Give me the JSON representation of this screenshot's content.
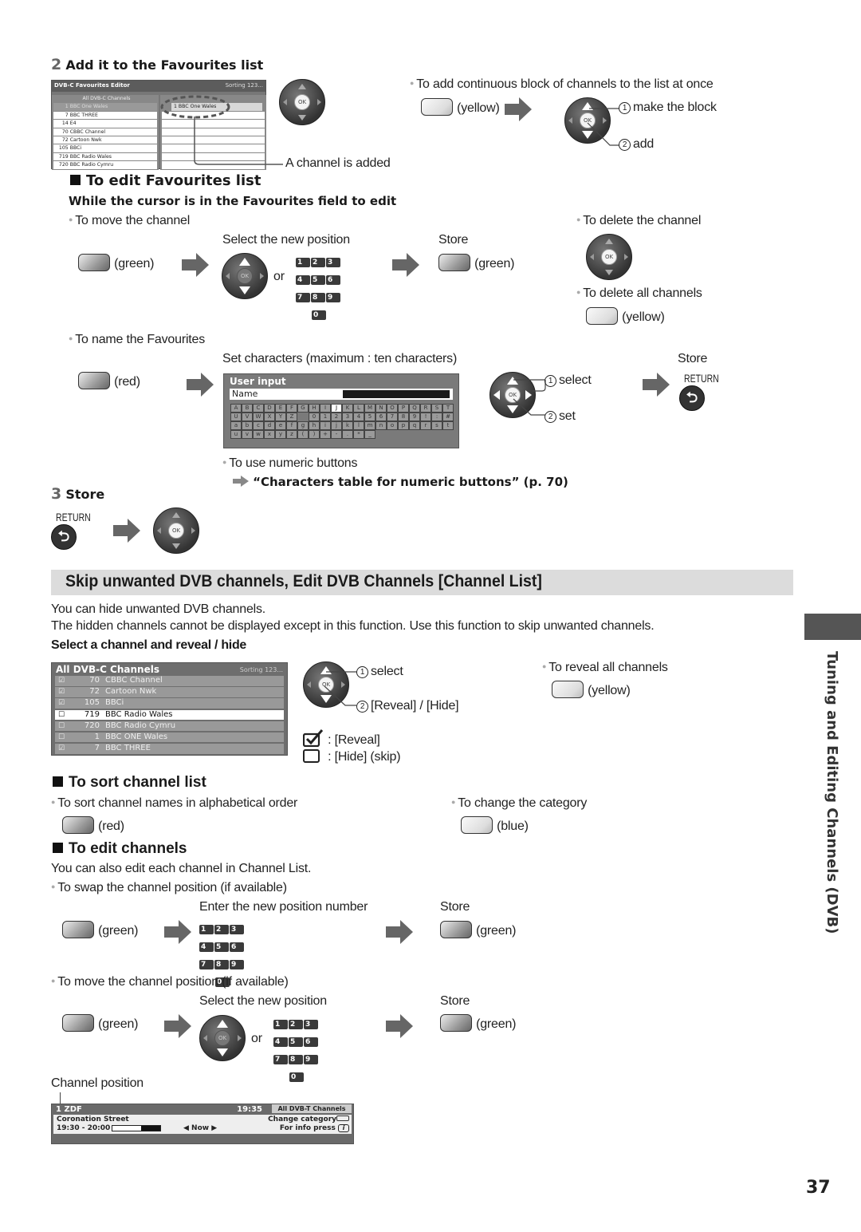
{
  "step2": {
    "num": "2",
    "title": "Add it to the Favourites list"
  },
  "fav_editor": {
    "title": "DVB-C Favourites Editor",
    "sorting": "Sorting 123...",
    "left_header": "All DVB-C Channels",
    "left_rows": [
      {
        "num": "1",
        "name": "BBC One Wales",
        "dim": true
      },
      {
        "num": "7",
        "name": "BBC THREE"
      },
      {
        "num": "14",
        "name": "E4"
      },
      {
        "num": "70",
        "name": "CBBC Channel"
      },
      {
        "num": "72",
        "name": "Cartoon Nwk"
      },
      {
        "num": "105",
        "name": "BBCi"
      },
      {
        "num": "719",
        "name": "BBC Radio Wales"
      },
      {
        "num": "720",
        "name": "BBC Radio Cymru"
      }
    ],
    "right_row": "1  BBC One Wales",
    "callout": "A channel is added"
  },
  "add_block": {
    "bullet": "To add continuous block of channels to the list at once",
    "button": "(yellow)",
    "step1": "make the block",
    "step2": "add",
    "n1": "1",
    "n2": "2"
  },
  "edit_fav": {
    "heading": "To edit Favourites list",
    "subheading": "While the cursor is in the Favourites field to edit",
    "move": {
      "bullet": "To move the channel",
      "button": "(green)",
      "select_label": "Select the new position",
      "or": "or",
      "store_label": "Store",
      "store_button": "(green)"
    },
    "delete": {
      "bullet": "To delete the channel"
    },
    "delete_all": {
      "bullet": "To delete all channels",
      "button": "(yellow)"
    },
    "name": {
      "bullet": "To name the Favourites",
      "button": "(red)",
      "set_label": "Set characters (maximum : ten characters)",
      "select": "select",
      "set": "set",
      "store_label": "Store",
      "return_label": "RETURN",
      "numeric_bullet": "To use numeric buttons",
      "numeric_ref": "“Characters table for numeric buttons” (p. 70)"
    }
  },
  "user_input": {
    "title": "User input",
    "name_label": "Name",
    "rows": [
      [
        "A",
        "B",
        "C",
        "D",
        "E",
        "F",
        "G",
        "H",
        "I",
        "J",
        "K",
        "L",
        "M",
        "N",
        "O",
        "P",
        "Q",
        "R",
        "S",
        "T"
      ],
      [
        "U",
        "V",
        "W",
        "X",
        "Y",
        "Z",
        "",
        "0",
        "1",
        "2",
        "3",
        "4",
        "5",
        "6",
        "7",
        "8",
        "9",
        "!",
        ":",
        "#"
      ],
      [
        "a",
        "b",
        "c",
        "d",
        "e",
        "f",
        "g",
        "h",
        "i",
        "j",
        "k",
        "l",
        "m",
        "n",
        "o",
        "p",
        "q",
        "r",
        "s",
        "t"
      ],
      [
        "u",
        "v",
        "w",
        "x",
        "y",
        "z",
        "(",
        ")",
        "+",
        "-",
        ".",
        "*",
        "_"
      ]
    ],
    "active_key": "J"
  },
  "numpad": [
    "1",
    "2",
    "3",
    "4",
    "5",
    "6",
    "7",
    "8",
    "9",
    "0"
  ],
  "step3": {
    "num": "3",
    "title": "Store",
    "return_label": "RETURN"
  },
  "skip_section": {
    "title": "Skip unwanted DVB channels, Edit DVB Channels [Channel List]",
    "intro1": "You can hide unwanted DVB channels.",
    "intro2": "The hidden channels cannot be displayed except in this function. Use this function to skip unwanted channels.",
    "subheading": "Select a channel and reveal / hide",
    "select": "select",
    "reveal_hide": "[Reveal] / [Hide]",
    "legend_reveal": ": [Reveal]",
    "legend_hide": ": [Hide] (skip)",
    "reveal_all_bullet": "To reveal all channels",
    "reveal_all_button": "(yellow)"
  },
  "channel_list": {
    "title": "All DVB-C Channels",
    "sorting": "Sorting 123...",
    "rows": [
      {
        "checked": true,
        "num": "70",
        "name": "CBBC Channel"
      },
      {
        "checked": true,
        "num": "72",
        "name": "Cartoon Nwk"
      },
      {
        "checked": true,
        "num": "105",
        "name": "BBCi"
      },
      {
        "checked": false,
        "num": "719",
        "name": "BBC Radio Wales",
        "selected": true
      },
      {
        "checked": false,
        "num": "720",
        "name": "BBC Radio Cymru"
      },
      {
        "checked": false,
        "num": "1",
        "name": "BBC ONE Wales"
      },
      {
        "checked": true,
        "num": "7",
        "name": "BBC THREE"
      }
    ]
  },
  "sort": {
    "heading": "To sort channel list",
    "alpha_bullet": "To sort channel names in alphabetical order",
    "alpha_button": "(red)",
    "category_bullet": "To change the category",
    "category_button": "(blue)"
  },
  "edit_channels": {
    "heading": "To edit channels",
    "intro": "You can also edit each channel in Channel List.",
    "swap_bullet": "To swap the channel position (if available)",
    "swap_button": "(green)",
    "enter_label": "Enter the new position number",
    "store_label": "Store",
    "store_button": "(green)",
    "move_bullet": "To move the channel position (if available)",
    "move_button": "(green)",
    "select_label": "Select the new position",
    "or": "or",
    "store2_label": "Store",
    "store2_button": "(green)",
    "channel_position": "Channel position"
  },
  "info_banner": {
    "channel": "1 ZDF",
    "time": "19:35",
    "category": "All DVB-T Channels",
    "programme": "Coronation Street",
    "slot": "19:30 - 20:00",
    "progress": 0.6,
    "now": "◀ Now ▶",
    "change_category": "Change category",
    "info_press": "For info press",
    "info_icon": "i"
  },
  "side_label": "Tuning and Editing Channels (DVB)",
  "page_number": "37"
}
